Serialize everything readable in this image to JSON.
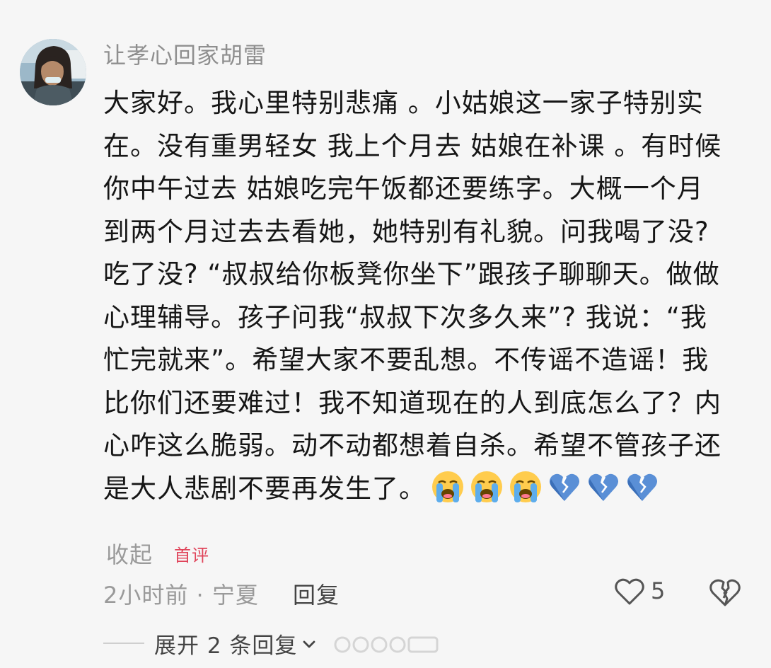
{
  "comment": {
    "username": "让孝心回家胡雷",
    "lines": [
      "大家好。我心里特别悲痛 。小姑娘这一家子特别实",
      "在。没有重男轻女 我上个月去 姑娘在补课 。有时候",
      "你中午过去 姑娘吃完午饭都还要练字。大概一个月",
      "到两个月过去去看她，她特别有礼貌。问我喝了没?",
      "吃了没? “叔叔给你板凳你坐下”跟孩子聊聊天。做做",
      "心理辅导。孩子问我“叔叔下次多久来”? 我说：“我",
      "忙完就来”。希望大家不要乱想。不传谣不造谣！我",
      "比你们还要难过！我不知道现在的人到底怎么了？内",
      "心咋这么脆弱。动不动都想着自杀。希望不管孩子还",
      "是大人悲剧不要再发生了。"
    ],
    "emojis": [
      "loudly-crying-face",
      "loudly-crying-face",
      "loudly-crying-face",
      "broken-heart",
      "broken-heart",
      "broken-heart"
    ],
    "collapse_label": "收起",
    "first_comment_badge": "首评",
    "time_location": "2小时前 · 宁夏",
    "reply_label": "回复",
    "like_count": "5",
    "expand_replies_label": "展开 2 条回复"
  },
  "colors": {
    "background": "#f6f6f6",
    "text": "#161616",
    "muted": "#9a9a9a",
    "badge": "#e0455b"
  }
}
